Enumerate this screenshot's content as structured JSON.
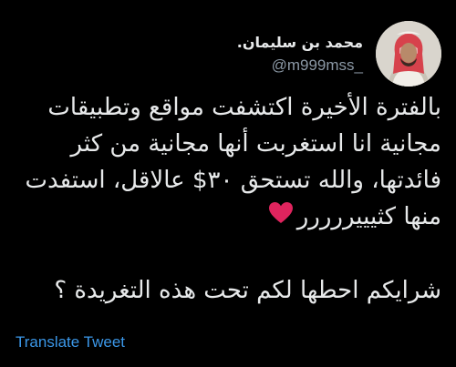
{
  "user": {
    "display_name": "محمد بن سليمان.",
    "handle": "@m999mss_",
    "avatar_icon": "profile-photo"
  },
  "tweet": {
    "lines": [
      "بالفترة الأخيرة اكتشفت مواقع وتطبيقات",
      "مجانية انا استغربت أنها مجانية من كثر",
      "فائدتها، والله تستحق ٣٠$ عالاقل، استفدت",
      "منها كثيييررررر"
    ],
    "question": "شرايكم احطها لكم تحت هذه التغريدة ؟"
  },
  "actions": {
    "translate_label": "Translate Tweet",
    "more_icon": "more-horizontal-icon"
  },
  "colors": {
    "background": "#000000",
    "text": "#e7e9ea",
    "secondary": "#8b98a5",
    "link": "#3b97e8",
    "heart": "#e0245e"
  }
}
